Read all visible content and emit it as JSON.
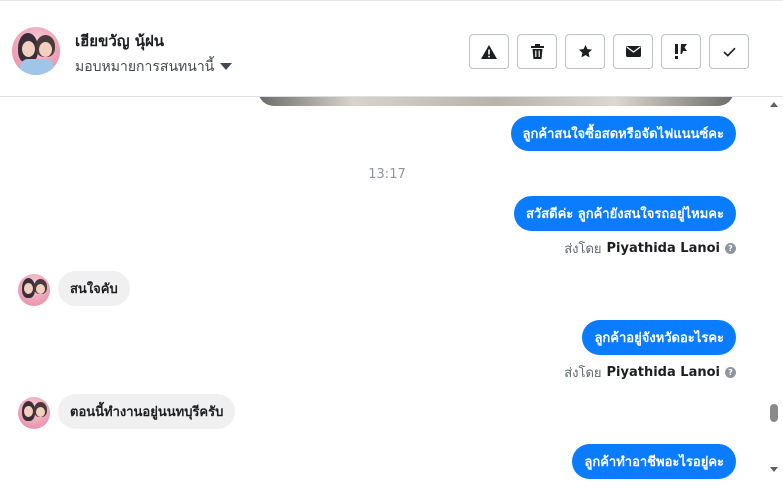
{
  "header": {
    "contact_name": "เฮียขวัญ นุ้ฝน",
    "assign_label": "มอบหมายการสนทนานี้",
    "toolbar": [
      {
        "name": "report-spam-button",
        "icon": "warning-icon"
      },
      {
        "name": "delete-button",
        "icon": "trash-icon"
      },
      {
        "name": "star-button",
        "icon": "star-icon"
      },
      {
        "name": "mark-unread-button",
        "icon": "envelope-icon"
      },
      {
        "name": "follow-up-button",
        "icon": "exclamation-flag-icon"
      },
      {
        "name": "mark-done-button",
        "icon": "checkmark-icon"
      }
    ]
  },
  "conversation": {
    "msg1": "ลูกค้าสนใจซื้อสดหรือจัดไฟแนนซ์คะ",
    "time1": "13:17",
    "msg2": "สวัสดีค่ะ ลูกค้ายังสนใจรถอยู่ไหมคะ",
    "sent_prefix": "ส่งโดย",
    "sender": "Piyathida Lanoi",
    "reply1": "สนใจคับ",
    "msg3": "ลูกค้าอยู่จังหวัดอะไรคะ",
    "reply2": "ตอนนี้ทำงานอยู่นนทบุรีครับ",
    "msg4": "ลูกค้าทำอาชีพอะไรอยู่คะ"
  },
  "colors": {
    "outgoing_bubble": "#0a7cff",
    "incoming_bubble": "#f0f0f0",
    "timestamp": "#90949c"
  }
}
